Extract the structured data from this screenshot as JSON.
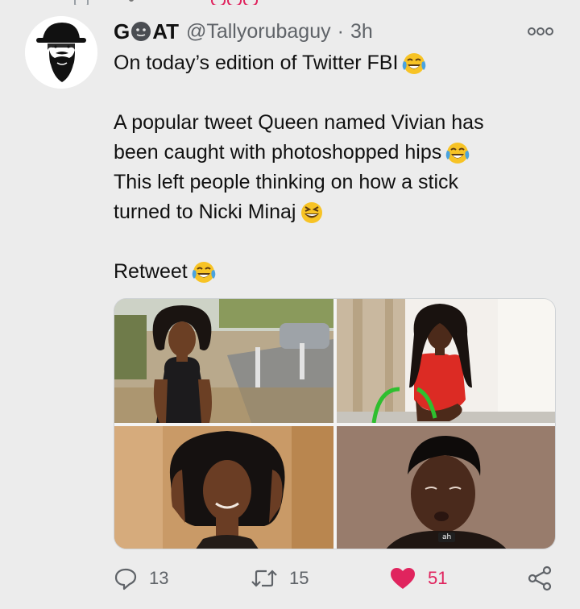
{
  "tweet": {
    "display_name_pre": "G",
    "display_name_emoji": "neutral-face-emoji",
    "display_name_post": "AT",
    "handle": "@Tallyorubaguy",
    "separator": "·",
    "time": "3h",
    "lines": [
      "On today’s  edition of Twitter FBI",
      "",
      "A popular tweet Queen named Vivian has",
      "been caught with photoshopped hips",
      "This left people thinking on how a stick",
      "turned to Nicki Minaj",
      "",
      "Retweet"
    ],
    "emojis": {
      "line_0": "face-with-tears-of-joy-emoji",
      "line_3": "face-with-tears-of-joy-emoji",
      "line_5": "grinning-squinting-face-emoji",
      "line_7": "face-with-tears-of-joy-emoji"
    },
    "media": {
      "tiles": [
        {
          "subject": "woman-curly-hair-street-photo"
        },
        {
          "subject": "woman-red-top-photo"
        },
        {
          "subject": "woman-curly-hair-closeup-photo"
        },
        {
          "subject": "young-man-reaction-photo",
          "caption": "ah"
        }
      ]
    },
    "actions": {
      "replies": "13",
      "retweets": "15",
      "likes": "51",
      "liked": true
    }
  },
  "colors": {
    "like_active": "#e0245e",
    "secondary_text": "#5f6368",
    "background": "#ececec"
  }
}
